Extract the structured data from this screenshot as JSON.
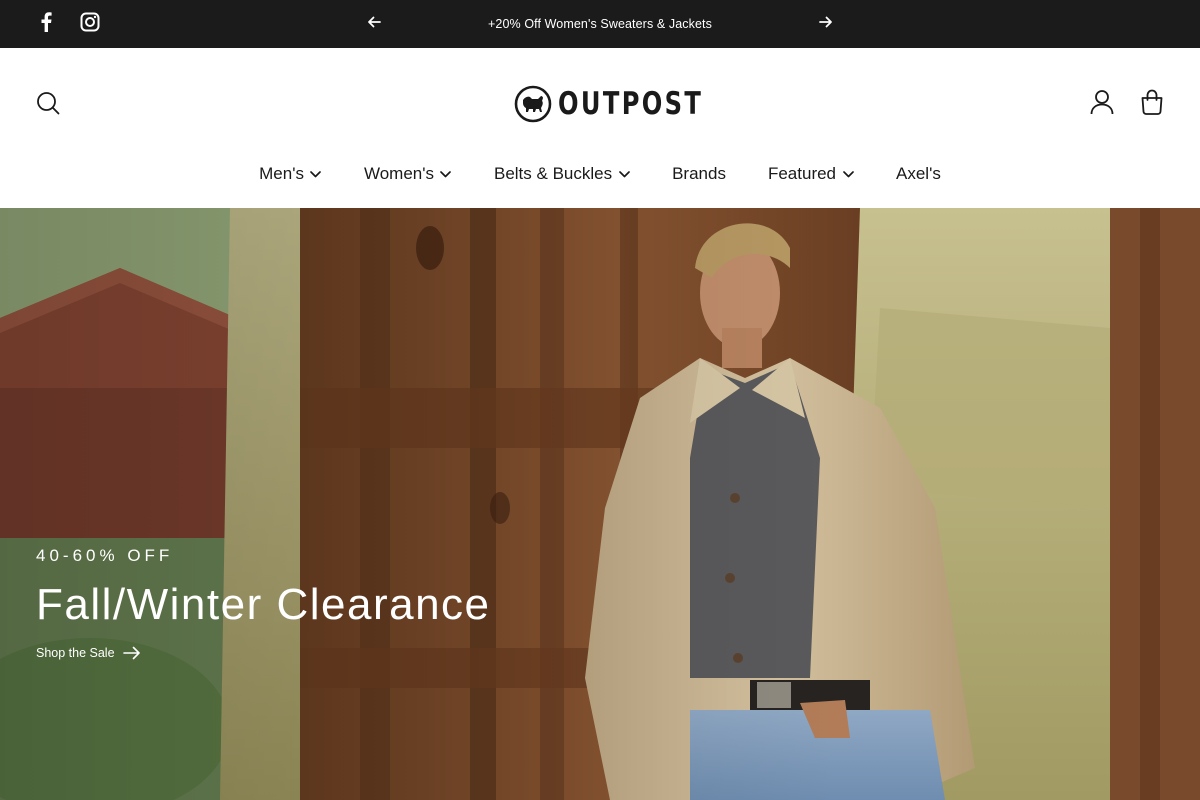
{
  "announcement": {
    "text": "+20% Off Women's Sweaters & Jackets",
    "prev_icon": "arrow-left-icon",
    "next_icon": "arrow-right-icon"
  },
  "social": [
    {
      "icon": "facebook-icon"
    },
    {
      "icon": "instagram-icon"
    }
  ],
  "header": {
    "logo_text": "OUTPOST",
    "logo_icon": "dog-badge-icon",
    "search_icon": "search-icon",
    "account_icon": "user-icon",
    "cart_icon": "shopping-bag-icon"
  },
  "nav": {
    "items": [
      {
        "label": "Men's",
        "has_dropdown": true
      },
      {
        "label": "Women's",
        "has_dropdown": true
      },
      {
        "label": "Belts & Buckles",
        "has_dropdown": true
      },
      {
        "label": "Brands",
        "has_dropdown": false
      },
      {
        "label": "Featured",
        "has_dropdown": true
      },
      {
        "label": "Axel's",
        "has_dropdown": false
      }
    ]
  },
  "hero": {
    "eyebrow": "40-60% OFF",
    "headline": "Fall/Winter Clearance",
    "cta_label": "Shop the Sale",
    "cta_icon": "arrow-right-icon"
  },
  "colors": {
    "topbar_bg": "#1b1b1b",
    "text_dark": "#1a1a1a",
    "hero_text": "#ffffff",
    "wood": "#7a4a2a",
    "hay": "#b9b27a",
    "jacket": "#cbb896"
  }
}
